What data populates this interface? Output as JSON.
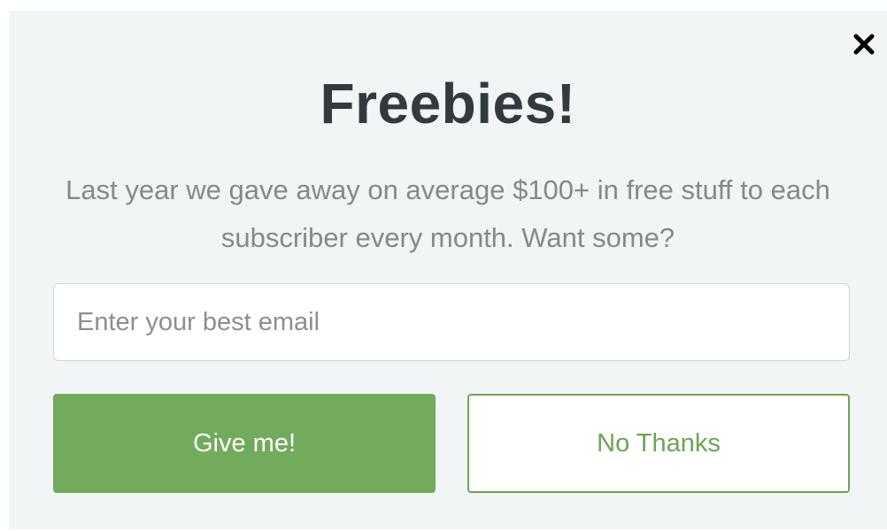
{
  "popup": {
    "title": "Freebies!",
    "subtitle": "Last year we gave away on average $100+ in free stuff to each subscriber every month. Want some?",
    "email": {
      "value": "",
      "placeholder": "Enter your best email"
    },
    "primary_button_label": "Give me!",
    "secondary_button_label": "No Thanks",
    "close_icon": "close-icon"
  },
  "colors": {
    "background": "#f2f5f5",
    "title": "#333a3f",
    "subtitle": "#85898c",
    "accent_green": "#72ab5b",
    "button_text_light": "#ffffff"
  }
}
